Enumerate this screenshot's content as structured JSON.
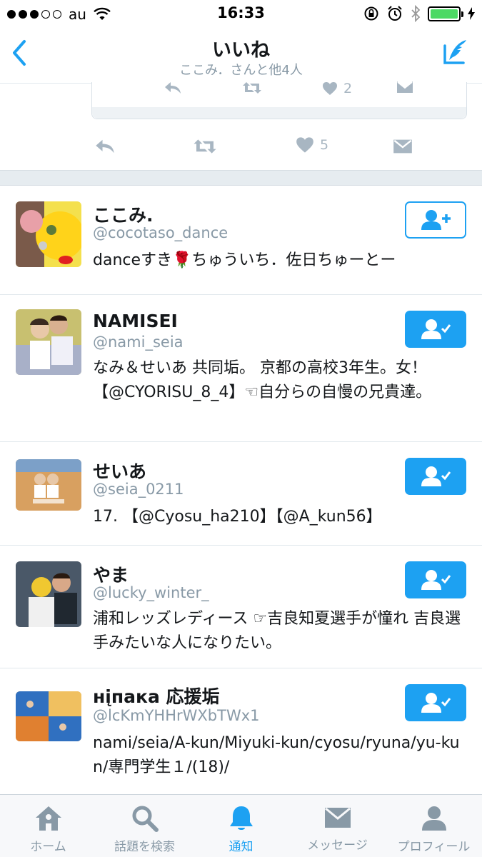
{
  "status_bar": {
    "carrier": "au",
    "time": "16:33"
  },
  "header": {
    "title": "いいね",
    "subtitle": "ここみ．さんと他4人"
  },
  "prev_tweet": {
    "quote_like_count": "2",
    "like_count": "5"
  },
  "users": [
    {
      "name": "ここみ.",
      "handle": "@cocotaso_dance",
      "bio": "danceすき🌹ちゅういち．佐日ちゅーとー",
      "following": false
    },
    {
      "name": "NAMISEI",
      "handle": "@nami_seia",
      "bio": "なみ＆せいあ 共同垢。 京都の高校3年生。女！【@CYORISU_8_4】☜自分らの自慢の兄貴達。",
      "following": true
    },
    {
      "name": "せいあ",
      "handle": "@seia_0211",
      "bio": "17. 【@Cyosu_ha210】【@A_kun56】",
      "following": true
    },
    {
      "name": "やま",
      "handle": "@lucky_winter_",
      "bio": "浦和レッズレディース ☞吉良知夏選手が憧れ 吉良選手みたいな人になりたい。",
      "following": true
    },
    {
      "name": "нįпака 応援垢",
      "handle": "@lcKmYHHrWXbTWx1",
      "bio": "nami/seia/A-kun/Miyuki-kun/cyosu/ryuna/yu-kun/専門学生１/(18)/",
      "following": true
    }
  ],
  "tabs": [
    {
      "label": "ホーム",
      "icon": "home-icon"
    },
    {
      "label": "話題を検索",
      "icon": "search-icon"
    },
    {
      "label": "通知",
      "icon": "bell-icon"
    },
    {
      "label": "メッセージ",
      "icon": "mail-icon"
    },
    {
      "label": "プロフィール",
      "icon": "profile-icon"
    }
  ],
  "colors": {
    "accent": "#1da1f2",
    "muted": "#8899a6",
    "battery": "#4cd964"
  }
}
